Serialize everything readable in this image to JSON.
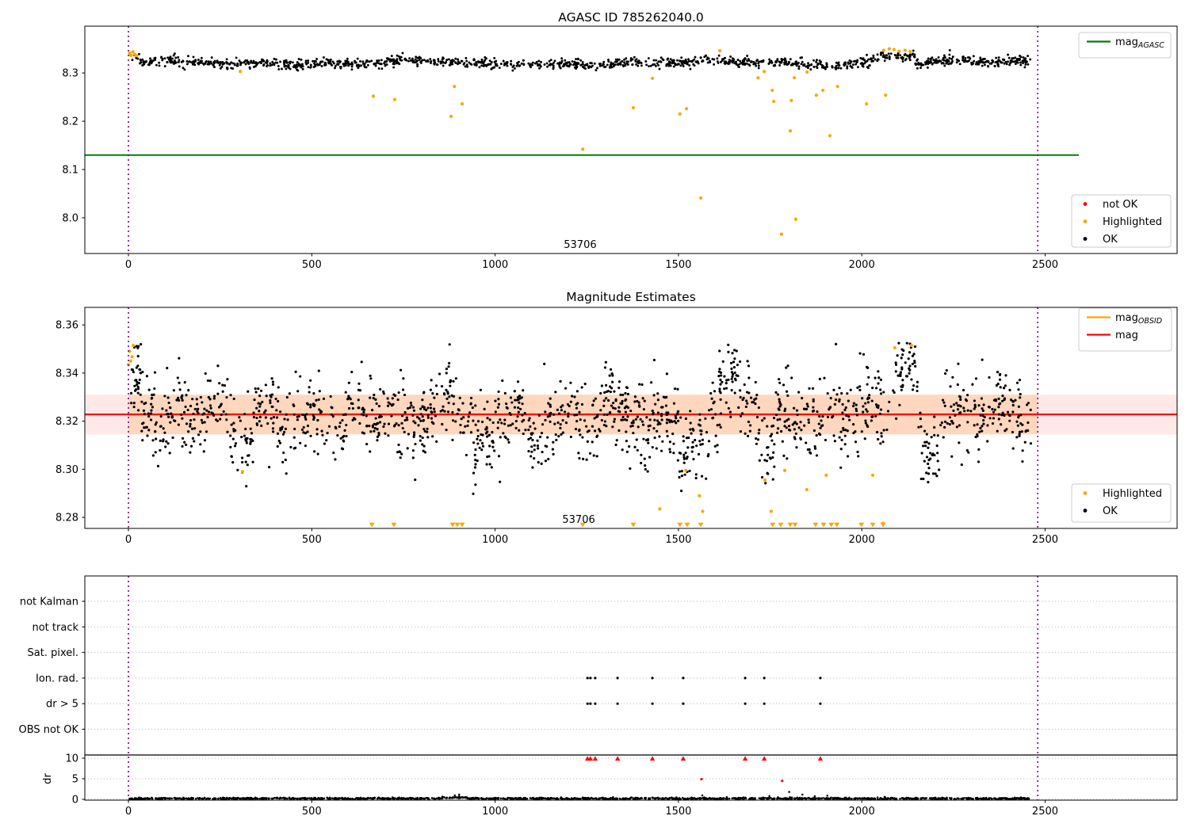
{
  "colors": {
    "ok": "#000000",
    "highlighted": "#ffa500",
    "not_ok": "#ff0000",
    "agasc_line": "#008000",
    "mag_line": "#ff0000",
    "obsid_line": "#ffa500",
    "vline": "#800080",
    "grid": "#bbbbbb",
    "band_pink": "rgba(255,0,0,0.09)",
    "band_peach": "rgba(255,140,0,0.18)",
    "spine": "#000000",
    "legend_border": "#cccccc"
  },
  "chart_data": [
    {
      "type": "scatter",
      "title": "AGASC ID 785262040.0",
      "xlim": [
        -119,
        2860
      ],
      "ylim": [
        7.926,
        8.397
      ],
      "xticks": [
        {
          "v": 0,
          "label": "0"
        },
        {
          "v": 500,
          "label": "500"
        },
        {
          "v": 1000,
          "label": "1000"
        },
        {
          "v": 1500,
          "label": "1500"
        },
        {
          "v": 2000,
          "label": "2000"
        },
        {
          "v": 2500,
          "label": "2500"
        }
      ],
      "yticks": [
        {
          "v": 8.0,
          "label": "8.0"
        },
        {
          "v": 8.1,
          "label": "8.1"
        },
        {
          "v": 8.2,
          "label": "8.2"
        },
        {
          "v": 8.3,
          "label": "8.3"
        }
      ],
      "vlines": [
        0,
        2480
      ],
      "ref_line": {
        "value": 8.13,
        "x_start": -119,
        "x_end": 2592
      },
      "annotation": {
        "text": "53706",
        "x": 1232
      },
      "legend_lines": [
        {
          "label": "mag",
          "sub": "AGASC",
          "color": "#008000"
        }
      ],
      "legend_points": [
        {
          "label": "not OK",
          "color": "#ff0000"
        },
        {
          "label": "Highlighted",
          "color": "#ffa500"
        },
        {
          "label": "OK",
          "color": "#000000"
        }
      ],
      "highlighted_points": [
        [
          3,
          8.341
        ],
        [
          7,
          8.3365
        ],
        [
          12,
          8.344
        ],
        [
          17,
          8.3385
        ],
        [
          22,
          8.336
        ],
        [
          305,
          8.303
        ],
        [
          668,
          8.252
        ],
        [
          726,
          8.245
        ],
        [
          880,
          8.21
        ],
        [
          889,
          8.272
        ],
        [
          910,
          8.236
        ],
        [
          1239,
          8.142
        ],
        [
          1377,
          8.228
        ],
        [
          1429,
          8.289
        ],
        [
          1504,
          8.215
        ],
        [
          1522,
          8.226
        ],
        [
          1561,
          8.041
        ],
        [
          1613,
          8.346
        ],
        [
          1717,
          8.29
        ],
        [
          1734,
          8.303
        ],
        [
          1756,
          8.264
        ],
        [
          1760,
          8.241
        ],
        [
          1781,
          7.966
        ],
        [
          1805,
          8.18
        ],
        [
          1808,
          8.243
        ],
        [
          1816,
          8.29
        ],
        [
          1820,
          7.997
        ],
        [
          1851,
          8.302
        ],
        [
          1876,
          8.254
        ],
        [
          1894,
          8.264
        ],
        [
          1913,
          8.17
        ],
        [
          1934,
          8.272
        ],
        [
          2013,
          8.236
        ],
        [
          2065,
          8.254
        ],
        [
          2060,
          8.347
        ],
        [
          2075,
          8.35
        ],
        [
          2088,
          8.3485
        ],
        [
          2102,
          8.345
        ],
        [
          2118,
          8.347
        ],
        [
          2132,
          8.3445
        ]
      ],
      "ok_profile": {
        "seed": 42,
        "n": 1400,
        "x_range": [
          8,
          2462
        ],
        "base": 8.321,
        "sigma": 0.005,
        "waves": [
          {
            "amp": 0.0035,
            "period": 760,
            "phase": 1.2
          },
          {
            "amp": 0.002,
            "period": 210,
            "phase": 4.0
          }
        ],
        "windows": [
          {
            "x0": 2030,
            "x1": 2145,
            "dy": 0.016
          },
          {
            "x0": 905,
            "x1": 1000,
            "dy": -0.0035
          },
          {
            "x0": -5,
            "x1": 30,
            "dy": 0.013
          }
        ],
        "tail": 0.012,
        "tail_mag": 0.009,
        "clamp": [
          8.289,
          8.353
        ]
      }
    },
    {
      "type": "scatter",
      "title": "Magnitude Estimates",
      "xlim": [
        -119,
        2860
      ],
      "ylim": [
        8.2754,
        8.3673
      ],
      "xticks": [
        {
          "v": 0,
          "label": "0"
        },
        {
          "v": 500,
          "label": "500"
        },
        {
          "v": 1000,
          "label": "1000"
        },
        {
          "v": 1500,
          "label": "1500"
        },
        {
          "v": 2000,
          "label": "2000"
        },
        {
          "v": 2500,
          "label": "2500"
        }
      ],
      "yticks": [
        {
          "v": 8.28,
          "label": "8.28"
        },
        {
          "v": 8.3,
          "label": "8.30"
        },
        {
          "v": 8.32,
          "label": "8.32"
        },
        {
          "v": 8.34,
          "label": "8.34"
        },
        {
          "v": 8.36,
          "label": "8.36"
        }
      ],
      "vlines": [
        0,
        2480
      ],
      "mag_line": {
        "value": 8.3228
      },
      "obsid_line": {
        "value": 8.3228,
        "x_start": 0,
        "x_end": 2480
      },
      "band": {
        "low": 8.3145,
        "high": 8.331
      },
      "band_overlap": {
        "x_start": 0,
        "x_end": 2480
      },
      "annotation": {
        "text": "53706",
        "x": 1228
      },
      "legend_lines": [
        {
          "label": "mag",
          "sub": "OBSID",
          "color": "#ffa500"
        },
        {
          "label": "mag",
          "sub": "",
          "color": "#ff0000"
        }
      ],
      "legend_points": [
        {
          "label": "Highlighted",
          "color": "#ffa500"
        },
        {
          "label": "OK",
          "color": "#000000"
        }
      ],
      "clip_triangle_y": 8.2768,
      "clip_triangle_x": [
        664,
        724,
        884,
        897,
        910,
        1239,
        1377,
        1504,
        1524,
        1561,
        1757,
        1779,
        1805,
        1818,
        1874,
        1896,
        1917,
        1932,
        1999,
        2030,
        2058
      ],
      "highlighted_points": [
        [
          0,
          8.3435
        ],
        [
          3,
          8.349
        ],
        [
          6,
          8.345
        ],
        [
          10,
          8.3468
        ],
        [
          13,
          8.3515
        ],
        [
          311,
          8.299
        ],
        [
          1449,
          8.2835
        ],
        [
          1520,
          8.2995
        ],
        [
          1557,
          8.289
        ],
        [
          1566,
          8.2825
        ],
        [
          1736,
          8.2955
        ],
        [
          1753,
          8.2825
        ],
        [
          1790,
          8.2995
        ],
        [
          1850,
          8.2915
        ],
        [
          1903,
          8.2975
        ],
        [
          2030,
          8.2975
        ],
        [
          2058,
          8.2775
        ],
        [
          2090,
          8.3505
        ],
        [
          2135,
          8.3515
        ]
      ],
      "ok_profile": {
        "seed": 7,
        "n": 1700,
        "x_range": [
          5,
          2462
        ],
        "base": 8.3228,
        "sigma": 0.0075,
        "waves": [
          {
            "amp": 0.0032,
            "period": 118,
            "phase": 0.6
          },
          {
            "amp": 0.0022,
            "period": 340,
            "phase": 2.3
          }
        ],
        "windows": [
          {
            "x0": -5,
            "x1": 35,
            "dy": 0.014
          },
          {
            "x0": 270,
            "x1": 335,
            "dy": -0.011
          },
          {
            "x0": 560,
            "x1": 600,
            "dy": -0.008
          },
          {
            "x0": 860,
            "x1": 905,
            "dy": 0.009
          },
          {
            "x0": 940,
            "x1": 1000,
            "dy": -0.013
          },
          {
            "x0": 1085,
            "x1": 1130,
            "dy": -0.009
          },
          {
            "x0": 1395,
            "x1": 1425,
            "dy": -0.008
          },
          {
            "x0": 1500,
            "x1": 1545,
            "dy": -0.012
          },
          {
            "x0": 1548,
            "x1": 1585,
            "dy": -0.013
          },
          {
            "x0": 1610,
            "x1": 1660,
            "dy": 0.01
          },
          {
            "x0": 1715,
            "x1": 1765,
            "dy": -0.012
          },
          {
            "x0": 2080,
            "x1": 2150,
            "dy": 0.019
          },
          {
            "x0": 2160,
            "x1": 2215,
            "dy": -0.013
          }
        ],
        "tail": 0.03,
        "tail_mag": 0.011,
        "clamp": [
          8.2785,
          8.353
        ]
      }
    },
    {
      "type": "scatter-flags",
      "xlim": [
        -119,
        2860
      ],
      "xticks": [
        {
          "v": 0,
          "label": "0"
        },
        {
          "v": 500,
          "label": "500"
        },
        {
          "v": 1000,
          "label": "1000"
        },
        {
          "v": 1500,
          "label": "1500"
        },
        {
          "v": 2000,
          "label": "2000"
        },
        {
          "v": 2500,
          "label": "2500"
        }
      ],
      "categories": [
        "not Kalman",
        "not track",
        "Sat. pixel.",
        "Ion. rad.",
        "dr > 5",
        "OBS not OK"
      ],
      "flag_points": {
        "Ion. rad.": [
          1252,
          1260,
          1273,
          1334,
          1429,
          1513,
          1682,
          1734,
          1887
        ],
        "dr > 5": [
          1252,
          1260,
          1273,
          1334,
          1429,
          1513,
          1682,
          1734,
          1887
        ]
      },
      "dr_axis": {
        "label": "dr",
        "ticks": [
          {
            "v": 0,
            "label": "0"
          },
          {
            "v": 5,
            "label": "5"
          },
          {
            "v": 10,
            "label": "10"
          }
        ]
      },
      "dr_capped_x": [
        1252,
        1260,
        1273,
        1334,
        1429,
        1513,
        1682,
        1734,
        1887
      ],
      "dr_red_points": [
        [
          1563,
          4.9
        ],
        [
          1783,
          4.5
        ]
      ],
      "dr_spikes": [
        [
          738,
          0.45
        ],
        [
          890,
          0.95
        ],
        [
          902,
          1.15
        ],
        [
          1180,
          0.5
        ],
        [
          1565,
          0.95
        ],
        [
          1632,
          0.55
        ],
        [
          1748,
          0.8
        ],
        [
          1802,
          1.8
        ],
        [
          1838,
          1.15
        ],
        [
          1872,
          0.75
        ],
        [
          1906,
          0.9
        ],
        [
          2062,
          0.6
        ]
      ],
      "dr_profile": {
        "seed": 99,
        "n": 1600,
        "x_range": [
          0,
          2462
        ],
        "base": 0.21,
        "sigma": 0.1,
        "windows": [
          {
            "x0": 855,
            "x1": 925,
            "dy": 0.2
          },
          {
            "x0": 390,
            "x1": 430,
            "dy": 0.06
          }
        ],
        "clamp": [
          0.02,
          2.6
        ]
      },
      "vlines": [
        0,
        2480
      ]
    }
  ]
}
